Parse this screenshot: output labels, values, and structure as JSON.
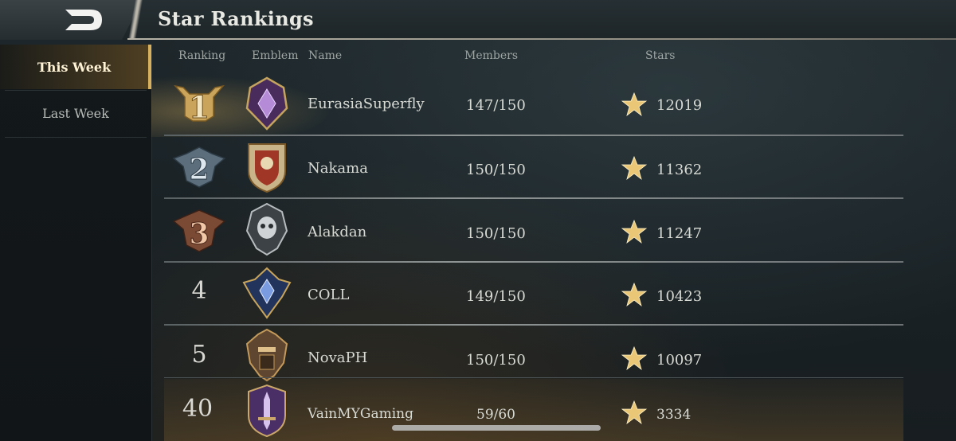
{
  "header": {
    "title": "Star Rankings"
  },
  "sidebar": {
    "tabs": [
      {
        "label": "This Week",
        "active": true
      },
      {
        "label": "Last Week",
        "active": false
      }
    ]
  },
  "columns": {
    "ranking": "Ranking",
    "emblem": "Emblem",
    "name": "Name",
    "members": "Members",
    "stars": "Stars"
  },
  "rows": [
    {
      "rank": "1",
      "name": "EurasiaSuperfly",
      "members": "147/150",
      "stars": "12019",
      "emblem_icon": "purple-crystal-emblem-icon"
    },
    {
      "rank": "2",
      "name": "Nakama",
      "members": "150/150",
      "stars": "11362",
      "emblem_icon": "red-gold-shield-emblem-icon"
    },
    {
      "rank": "3",
      "name": "Alakdan",
      "members": "150/150",
      "stars": "11247",
      "emblem_icon": "silver-skull-emblem-icon"
    },
    {
      "rank": "4",
      "name": "COLL",
      "members": "149/150",
      "stars": "10423",
      "emblem_icon": "blue-winged-emblem-icon"
    },
    {
      "rank": "5",
      "name": "NovaPH",
      "members": "150/150",
      "stars": "10097",
      "emblem_icon": "bronze-helmet-emblem-icon"
    },
    {
      "rank": "40",
      "name": "VainMYGaming",
      "members": "59/60",
      "stars": "3334",
      "emblem_icon": "purple-sword-emblem-icon"
    }
  ],
  "colors": {
    "gold": "#d8b15f",
    "silver": "#8a9aa6",
    "bronze": "#b07050",
    "accent_line": "#b7b3a6"
  }
}
